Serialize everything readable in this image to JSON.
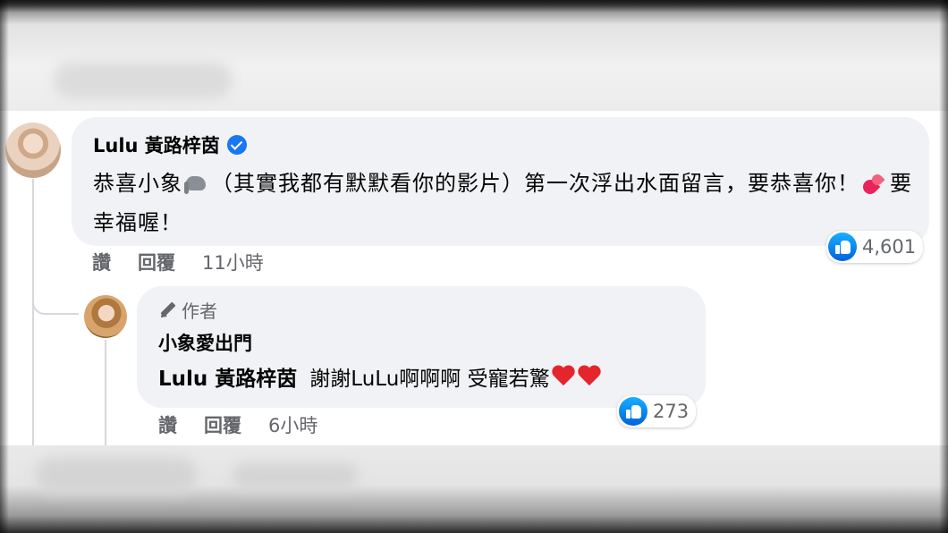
{
  "comment": {
    "author": "Lulu 黃路梓茵",
    "text_part1": "恭喜小象",
    "text_part2": "（其實我都有默默看你的影片）第一次浮出水面留言，要恭喜你！",
    "text_part3": "要幸福喔！",
    "actions": {
      "like": "讚",
      "reply": "回覆",
      "time": "11小時"
    },
    "reaction_count": "4,601"
  },
  "reply": {
    "badge": "作者",
    "author": "小象愛出門",
    "mention": "Lulu 黃路梓茵",
    "text": "謝謝LuLu啊啊啊 受寵若驚",
    "actions": {
      "like": "讚",
      "reply": "回覆",
      "time": "6小時"
    },
    "reaction_count": "273"
  },
  "colors": {
    "bubble": "#f0f2f5",
    "accent": "#1877f2",
    "secondary_text": "#65676b",
    "heart": "#e4262c"
  }
}
